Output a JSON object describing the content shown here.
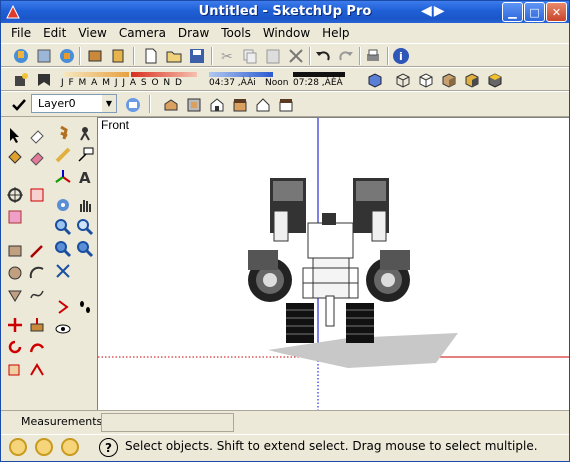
{
  "window": {
    "title": "Untitled - SketchUp Pro",
    "controls": [
      "minimize",
      "maximize",
      "close"
    ]
  },
  "menu": [
    {
      "label": "File"
    },
    {
      "label": "Edit"
    },
    {
      "label": "View"
    },
    {
      "label": "Camera"
    },
    {
      "label": "Draw"
    },
    {
      "label": "Tools"
    },
    {
      "label": "Window"
    },
    {
      "label": "Help"
    }
  ],
  "shadow": {
    "months": "J F M A M J J A S O N D",
    "time_start": "04:37 ,ÀÀi",
    "noon": "Noon",
    "time_end": "07:28 ,ÀÈÀ"
  },
  "layer": {
    "current": "Layer0"
  },
  "viewport": {
    "scene": "Front"
  },
  "measurements": {
    "label": "Measurements",
    "value": ""
  },
  "status": {
    "text": "Select objects. Shift to extend select. Drag mouse to select multiple."
  },
  "colors": {
    "title_blue": "#1f5fd6",
    "axis_red": "#cc0000",
    "axis_green": "#00aa00",
    "axis_blue": "#0000cc"
  }
}
